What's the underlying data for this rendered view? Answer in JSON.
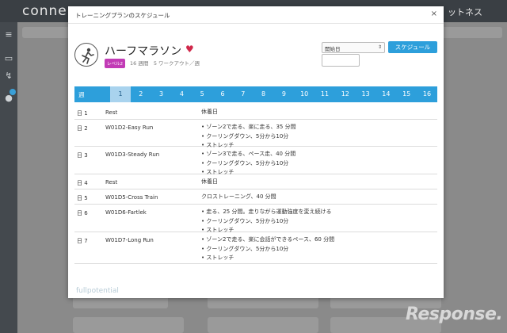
{
  "background": {
    "logo": "conne",
    "header_right": "ットネス"
  },
  "modal": {
    "title": "トレーニングプランのスケジュール",
    "close_glyph": "×"
  },
  "plan": {
    "name": "ハーフマラソン",
    "level": "レベル2",
    "meta": "16 週間　5 ワークアウト／週"
  },
  "controls": {
    "start_select": "開始日",
    "schedule_button": "スケジュール"
  },
  "weeks": {
    "label": "週",
    "numbers": [
      "1",
      "2",
      "3",
      "4",
      "5",
      "6",
      "7",
      "8",
      "9",
      "10",
      "11",
      "12",
      "13",
      "14",
      "15",
      "16"
    ],
    "active": "1"
  },
  "days": [
    {
      "day": "日 1",
      "name": "Rest",
      "lines": [
        "休養日"
      ]
    },
    {
      "day": "日 2",
      "name": "W01D2-Easy Run",
      "lines": [
        "• ゾーン2で走る、楽に走る、35 分間",
        "• クーリングダウン、5分から10分",
        "• ストレッチ"
      ]
    },
    {
      "day": "日 3",
      "name": "W01D3-Steady Run",
      "lines": [
        "• ゾーン3で走る、ペース走、40 分間",
        "• クーリングダウン、5分から10分",
        "• ストレッチ"
      ]
    },
    {
      "day": "日 4",
      "name": "Rest",
      "lines": [
        "休養日"
      ]
    },
    {
      "day": "日 5",
      "name": "W01D5-Cross Train",
      "lines": [
        "クロストレーニング、40 分間"
      ]
    },
    {
      "day": "日 6",
      "name": "W01D6-Fartlek",
      "lines": [
        "• 走る、25 分間。走りながら運動強度を変え続ける",
        "• クーリングダウン、5分から10分",
        "• ストレッチ"
      ]
    },
    {
      "day": "日 7",
      "name": "W01D7-Long Run",
      "lines": [
        "• ゾーン2で走る、楽に会話ができるペース、60 分間",
        "• クーリングダウン、5分から10分",
        "• ストレッチ"
      ]
    }
  ],
  "footer": {
    "logo_a": "full",
    "logo_b": "potential"
  },
  "watermark": "Response."
}
